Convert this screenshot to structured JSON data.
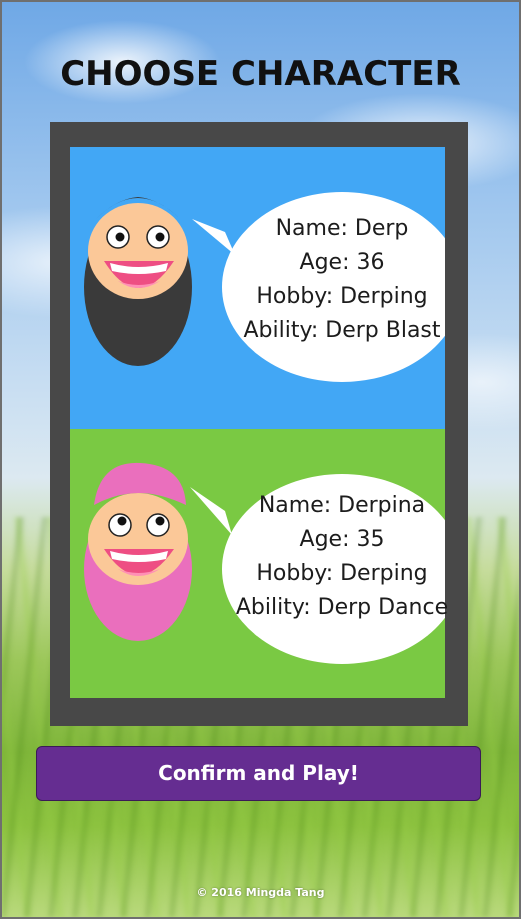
{
  "title": "CHOOSE CHARACTER",
  "characters": [
    {
      "name_line": "Name: Derp",
      "age_line": "Age: 36",
      "hobby_line": "Hobby: Derping",
      "ability_line": "Ability: Derp Blast",
      "panel_color": "#42a7f5",
      "hair_color": "#3a3a3a"
    },
    {
      "name_line": "Name: Derpina",
      "age_line": "Age: 35",
      "hobby_line": "Hobby: Derping",
      "ability_line": "Ability: Derp Dance",
      "panel_color": "#7ac943",
      "hair_color": "#ea6fbd"
    }
  ],
  "confirm_button": "Confirm and Play!",
  "footer": "© 2016 Mingda Tang",
  "colors": {
    "frame": "#484848",
    "button": "#652d91",
    "skin": "#fbc898",
    "mouth": "#ee4e83",
    "tongue": "#ff8fb5"
  }
}
